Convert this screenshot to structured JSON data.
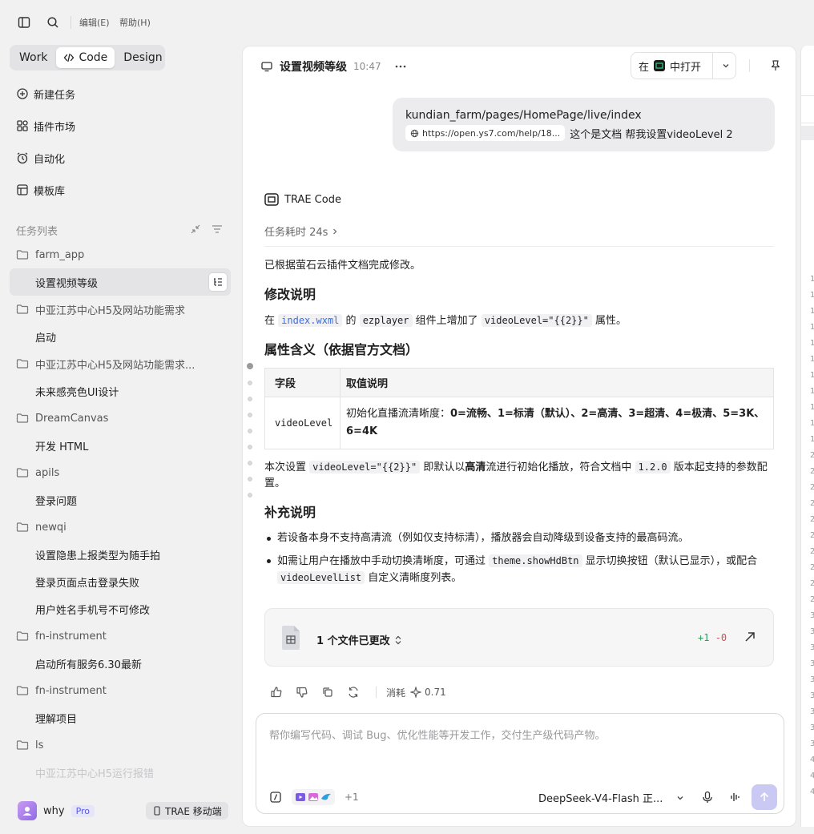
{
  "menubar": {
    "edit": "编辑(E)",
    "help": "帮助(H)"
  },
  "modes": [
    {
      "label": "Work",
      "active": false
    },
    {
      "label": "Code",
      "active": true
    },
    {
      "label": "Design",
      "active": false
    }
  ],
  "nav": {
    "new_task": "新建任务",
    "plugins": "插件市场",
    "automation": "自动化",
    "templates": "模板库"
  },
  "task_list": {
    "title": "任务列表",
    "groups": [
      {
        "folder": "farm_app",
        "tasks": [
          "设置视频等级"
        ]
      },
      {
        "folder": "中亚江苏中心H5及网站功能需求",
        "tasks": [
          "启动"
        ]
      },
      {
        "folder": "中亚江苏中心H5及网站功能需求...",
        "tasks": [
          "未来感亮色UI设计"
        ]
      },
      {
        "folder": "DreamCanvas",
        "tasks": [
          "开发 HTML"
        ]
      },
      {
        "folder": "apils",
        "tasks": [
          "登录问题"
        ]
      },
      {
        "folder": "newqi",
        "tasks": [
          "设置隐患上报类型为随手拍",
          "登录页面点击登录失败",
          "用户姓名手机号不可修改"
        ]
      },
      {
        "folder": "fn-instrument",
        "tasks": [
          "启动所有服务6.30最新"
        ]
      },
      {
        "folder": "fn-instrument",
        "tasks": [
          "理解项目"
        ]
      },
      {
        "folder": "ls",
        "tasks": [
          "中亚江苏中心H5运行报错"
        ]
      }
    ]
  },
  "user": {
    "name": "why",
    "badge": "Pro",
    "mobile": "TRAE 移动端"
  },
  "chat": {
    "title": "设置视频等级",
    "time": "10:47",
    "open_in_prefix": "在",
    "open_in_suffix": "中打开",
    "user_message": {
      "path": "kundian_farm/pages/HomePage/live/index",
      "link": "https://open.ys7.com/help/18...",
      "text": "这个是文档 帮我设置videoLevel 2"
    },
    "agent": "TRAE Code",
    "duration": "任务耗时 24s",
    "summary": "已根据萤石云插件文档完成修改。",
    "h_change": "修改说明",
    "change": {
      "prefix": "在",
      "file": "index.wxml",
      "mid1": "的",
      "component": "ezplayer",
      "mid2": "组件上增加了",
      "attr": "videoLevel=\"{{2}}\"",
      "suffix": "属性。"
    },
    "h_meaning": "属性含义（依据官方文档）",
    "table": {
      "headers": [
        "字段",
        "取值说明"
      ],
      "field": "videoLevel",
      "desc_prefix": "初始化直播流清晰度：",
      "desc_bold": "0=流畅、1=标清（默认）、2=高清、3=超清、4=极清、5=3K、6=4K"
    },
    "note": {
      "p1": "本次设置",
      "code1": "videoLevel=\"{{2}}\"",
      "p2": "即默认以",
      "bold": "高清",
      "p3": "流进行初始化播放，符合文档中",
      "code2": "1.2.0",
      "p4": "版本起支持的参数配置。"
    },
    "h_extra": "补充说明",
    "bullet1": "若设备本身不支持高清流（例如仅支持标清），播放器会自动降级到设备支持的最高码流。",
    "bullet2": {
      "p1": "如需让用户在播放中手动切换清晰度，可通过",
      "code1": "theme.showHdBtn",
      "p2": "显示切换按钮（默认已显示），或配合",
      "code2": "videoLevelList",
      "p3": "自定义清晰度列表。"
    },
    "files_changed": "1 个文件已更改",
    "diff_add": "+1",
    "diff_del": "-0",
    "cost_label": "消耗",
    "cost_value": "0.71"
  },
  "composer": {
    "placeholder": "帮你编写代码、调试 Bug、优化性能等开发工作，交付生产级代码产物。",
    "more_count": "+1",
    "model": "DeepSeek-V4-Flash 正..."
  },
  "line_numbers": [
    "1",
    "1",
    "1",
    "1",
    "1",
    "1",
    "1",
    "1",
    "1",
    "1",
    "1",
    "2",
    "2",
    "2",
    "2",
    "2",
    "2",
    "2",
    "2",
    "2",
    "2",
    "3",
    "3",
    "3",
    "3",
    "3",
    "3",
    "3",
    "3",
    "3",
    "4",
    "4",
    "4"
  ],
  "colors": {
    "accent": "#5b5bd6",
    "diff_add": "#2f9e5c",
    "diff_del": "#e5484d",
    "link": "#3a6fe0"
  }
}
